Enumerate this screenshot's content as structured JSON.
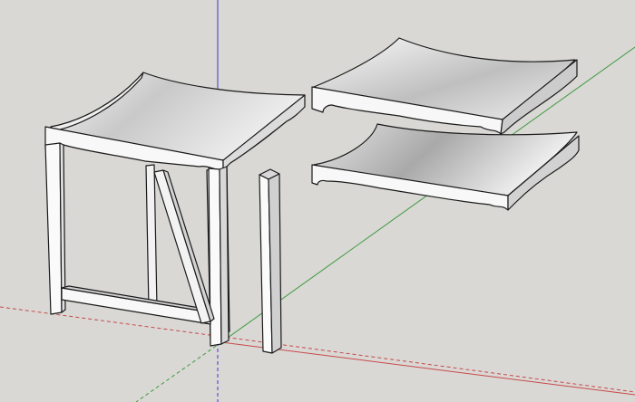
{
  "app": {
    "window_title": ""
  },
  "colors": {
    "background": "#d9d8d5",
    "axis_red": "#c84a4a",
    "axis_green": "#3f9a3f",
    "axis_blue": "#3a3ad0",
    "face_white": "#fafafa",
    "face_shade": "#bdbdbd",
    "edge": "#1a1a1a"
  },
  "scene": {
    "objects": [
      {
        "name": "stool-assembly",
        "icon": "3d-model"
      },
      {
        "name": "loose-leg",
        "icon": "3d-model"
      },
      {
        "name": "seat-top-copy",
        "icon": "3d-model"
      },
      {
        "name": "seat-bottom-copy",
        "icon": "3d-model"
      }
    ],
    "axes": [
      "red",
      "green",
      "blue"
    ]
  }
}
